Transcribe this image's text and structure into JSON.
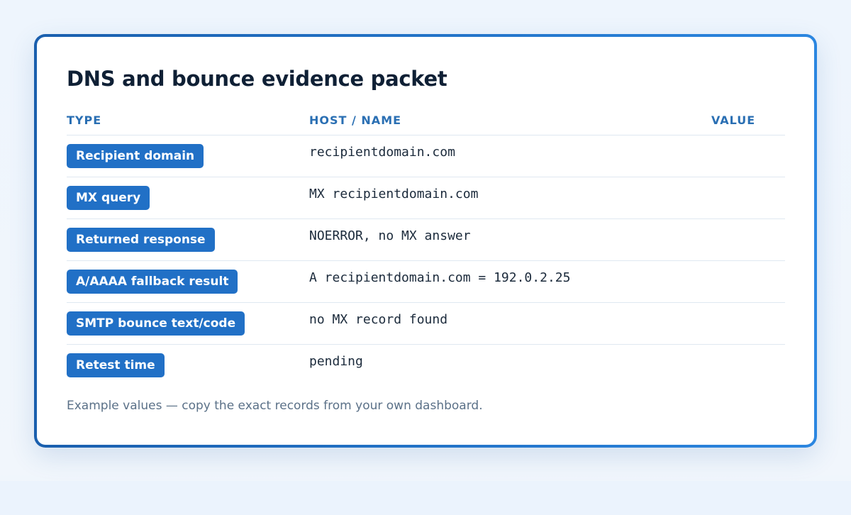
{
  "card": {
    "title": "DNS and bounce evidence packet",
    "footnote": "Example values — copy the exact records from your own dashboard."
  },
  "table": {
    "headers": {
      "type": "TYPE",
      "host": "HOST / NAME",
      "value": "VALUE"
    },
    "rows": [
      {
        "type": "Recipient domain",
        "host": "recipientdomain.com",
        "value": ""
      },
      {
        "type": "MX query",
        "host": "MX recipientdomain.com",
        "value": ""
      },
      {
        "type": "Returned response",
        "host": "NOERROR, no MX answer",
        "value": ""
      },
      {
        "type": "A/AAAA fallback result",
        "host": "A recipientdomain.com = 192.0.2.25",
        "value": ""
      },
      {
        "type": "SMTP bounce text/code",
        "host": "no MX record found",
        "value": ""
      },
      {
        "type": "Retest time",
        "host": "pending",
        "value": ""
      }
    ]
  },
  "colors": {
    "accent": "#2170c6",
    "border_start": "#1a5fae",
    "border_end": "#2b86e0",
    "header_text": "#2a6fb3",
    "title_text": "#0f2035"
  }
}
